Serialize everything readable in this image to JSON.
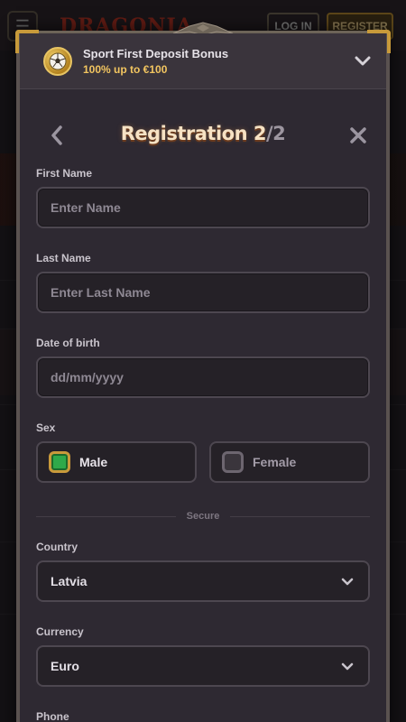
{
  "background": {
    "logo": "DRAGONIA",
    "login_label": "LOG IN",
    "register_label": "REGISTER"
  },
  "bonus": {
    "title": "Sport First Deposit Bonus",
    "subtitle": "100% up to €100",
    "icon": "soccer-ball-icon"
  },
  "registration": {
    "title": "Registration 2",
    "step": "/2"
  },
  "form": {
    "first_name": {
      "label": "First Name",
      "placeholder": "Enter Name"
    },
    "last_name": {
      "label": "Last Name",
      "placeholder": "Enter Last Name"
    },
    "dob": {
      "label": "Date of birth",
      "placeholder": "dd/mm/yyyy"
    },
    "sex": {
      "label": "Sex",
      "male": "Male",
      "female": "Female",
      "selected": "Male"
    },
    "divider": "Secure",
    "country": {
      "label": "Country",
      "value": "Latvia"
    },
    "currency": {
      "label": "Currency",
      "value": "Euro"
    },
    "phone": {
      "label": "Phone"
    }
  },
  "colors": {
    "accent_gold": "#c89a3a",
    "selected_green": "#2fa94a",
    "title_cream": "#f6e2c4"
  }
}
